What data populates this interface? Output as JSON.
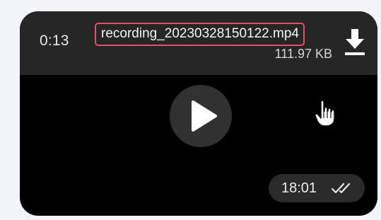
{
  "message": {
    "duration": "0:13",
    "file_name": "recording_20230328150122.mp4",
    "file_size": "111.97 KB",
    "sent_time": "18:01",
    "read_status_icon": "double-check-icon"
  },
  "icons": {
    "download": "download-icon",
    "play": "play-icon",
    "cursor": "hand-pointer-icon"
  },
  "colors": {
    "background": "#f2f4f8",
    "card": "#000000",
    "header": "#262626",
    "highlight_border": "#e0525f",
    "text": "#f4f4f4"
  }
}
